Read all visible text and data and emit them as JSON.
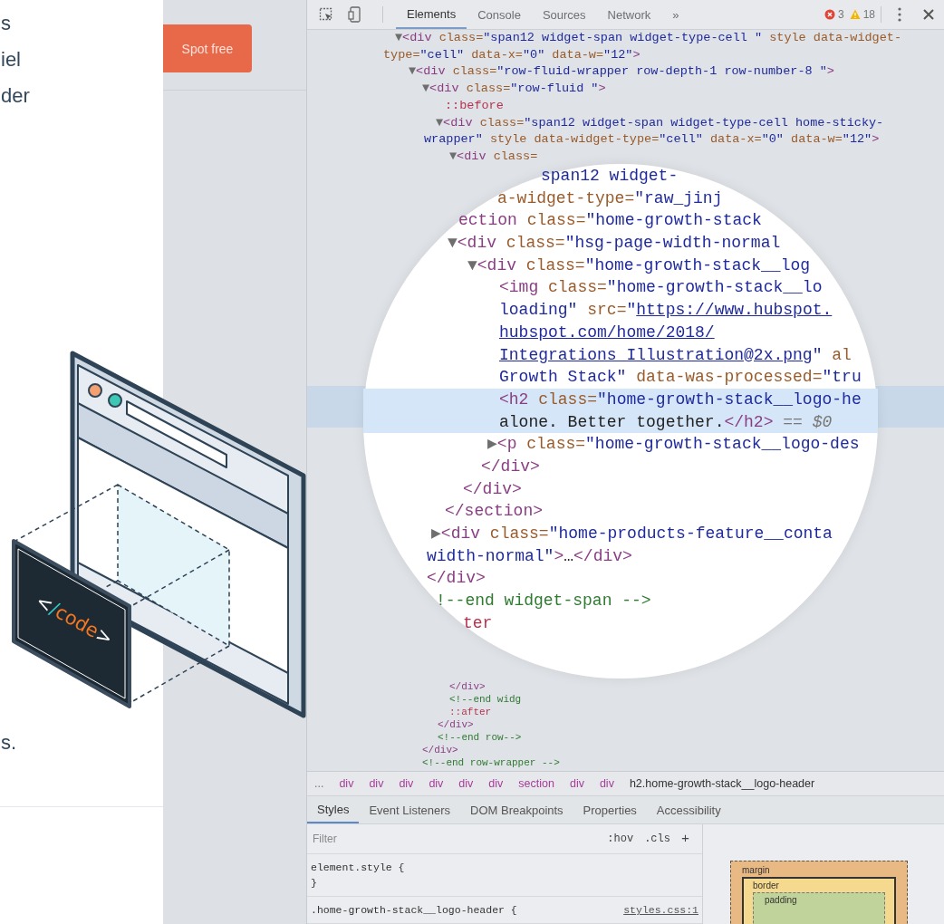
{
  "page": {
    "text_fragments": [
      "s",
      "iel",
      "der"
    ],
    "bottom_fragment": "s.",
    "cta_button": "Spot free"
  },
  "illustration": {
    "code_label": [
      {
        "text": "<",
        "kind": "bracket"
      },
      {
        "text": "/",
        "kind": "slash"
      },
      {
        "text": "code",
        "kind": "word"
      },
      {
        "text": ">",
        "kind": "bracket"
      }
    ]
  },
  "devtools": {
    "toolbar": {
      "tabs": [
        {
          "label": "Elements",
          "selected": true
        },
        {
          "label": "Console",
          "selected": false
        },
        {
          "label": "Sources",
          "selected": false
        },
        {
          "label": "Network",
          "selected": false
        }
      ],
      "overflow": "»",
      "errors": "3",
      "warnings": "18"
    },
    "dom_lines": [
      {
        "segments": [
          {
            "text": "▼",
            "kind": "arrow"
          },
          {
            "text": "<div ",
            "kind": "tag"
          },
          {
            "text": "class=",
            "kind": "attr"
          },
          {
            "text": "\"span12 widget-span widget-type-cell \"",
            "kind": "val"
          },
          {
            "text": " style data-widget-",
            "kind": "attr"
          }
        ]
      },
      {
        "segments": [
          {
            "text": "type=",
            "kind": "attr"
          },
          {
            "text": "\"cell\"",
            "kind": "val"
          },
          {
            "text": " data-x=",
            "kind": "attr"
          },
          {
            "text": "\"0\"",
            "kind": "val"
          },
          {
            "text": " data-w=",
            "kind": "attr"
          },
          {
            "text": "\"12\"",
            "kind": "val"
          },
          {
            "text": ">",
            "kind": "tag"
          }
        ]
      },
      {
        "segments": [
          {
            "text": "▼",
            "kind": "arrow"
          },
          {
            "text": "<div ",
            "kind": "tag"
          },
          {
            "text": "class=",
            "kind": "attr"
          },
          {
            "text": "\"row-fluid-wrapper row-depth-1 row-number-8 \"",
            "kind": "val"
          },
          {
            "text": ">",
            "kind": "tag"
          }
        ]
      },
      {
        "segments": [
          {
            "text": "▼",
            "kind": "arrow"
          },
          {
            "text": "<div ",
            "kind": "tag"
          },
          {
            "text": "class=",
            "kind": "attr"
          },
          {
            "text": "\"row-fluid \"",
            "kind": "val"
          },
          {
            "text": ">",
            "kind": "tag"
          }
        ]
      },
      {
        "segments": [
          {
            "text": "::before",
            "kind": "pseudo"
          }
        ]
      },
      {
        "segments": [
          {
            "text": "▼",
            "kind": "arrow"
          },
          {
            "text": "<div ",
            "kind": "tag"
          },
          {
            "text": "class=",
            "kind": "attr"
          },
          {
            "text": "\"span12 widget-span widget-type-cell home-sticky-",
            "kind": "val"
          }
        ]
      },
      {
        "segments": [
          {
            "text": "wrapper\"",
            "kind": "val"
          },
          {
            "text": " style data-widget-type=",
            "kind": "attr"
          },
          {
            "text": "\"cell\"",
            "kind": "val"
          },
          {
            "text": " data-x=",
            "kind": "attr"
          },
          {
            "text": "\"0\"",
            "kind": "val"
          },
          {
            "text": " data-w=",
            "kind": "attr"
          },
          {
            "text": "\"12\"",
            "kind": "val"
          },
          {
            "text": ">",
            "kind": "tag"
          }
        ]
      },
      {
        "segments": [
          {
            "text": "▼",
            "kind": "arrow"
          },
          {
            "text": "<div ",
            "kind": "tag"
          },
          {
            "text": "class=",
            "kind": "attr"
          }
        ]
      }
    ],
    "magnified_lines": [
      {
        "selected": false,
        "segments": [
          {
            "text": "span12 widget-",
            "kind": "val"
          }
        ]
      },
      {
        "selected": false,
        "segments": [
          {
            "text": "a-widget-type=",
            "kind": "attr"
          },
          {
            "text": "\"raw_jinj",
            "kind": "val"
          }
        ]
      },
      {
        "selected": false,
        "segments": [
          {
            "text": "ection ",
            "kind": "tag"
          },
          {
            "text": "class=",
            "kind": "attr"
          },
          {
            "text": "\"home-growth-stack",
            "kind": "val"
          }
        ]
      },
      {
        "selected": false,
        "segments": [
          {
            "text": "▼",
            "kind": "arrow"
          },
          {
            "text": "<div ",
            "kind": "tag"
          },
          {
            "text": "class=",
            "kind": "attr"
          },
          {
            "text": "\"hsg-page-width-normal",
            "kind": "val"
          }
        ]
      },
      {
        "selected": false,
        "segments": [
          {
            "text": "▼",
            "kind": "arrow"
          },
          {
            "text": "<div ",
            "kind": "tag"
          },
          {
            "text": "class=",
            "kind": "attr"
          },
          {
            "text": "\"home-growth-stack__log",
            "kind": "val"
          }
        ]
      },
      {
        "selected": false,
        "segments": [
          {
            "text": "<img ",
            "kind": "tag"
          },
          {
            "text": "class=",
            "kind": "attr"
          },
          {
            "text": "\"home-growth-stack__lo",
            "kind": "val"
          }
        ]
      },
      {
        "selected": false,
        "segments": [
          {
            "text": "loading\"",
            "kind": "val"
          },
          {
            "text": " src=",
            "kind": "attr"
          },
          {
            "text": "\"",
            "kind": "val"
          },
          {
            "text": "https://www.hubspot.",
            "kind": "link"
          }
        ]
      },
      {
        "selected": false,
        "segments": [
          {
            "text": "hubspot.com/home/2018/",
            "kind": "link"
          }
        ]
      },
      {
        "selected": false,
        "segments": [
          {
            "text": "Integrations Illustration@2x.png",
            "kind": "link"
          },
          {
            "text": "\"",
            "kind": "val"
          },
          {
            "text": " al",
            "kind": "attr"
          }
        ]
      },
      {
        "selected": false,
        "segments": [
          {
            "text": "Growth Stack\"",
            "kind": "val"
          },
          {
            "text": " data-was-processed=",
            "kind": "attr"
          },
          {
            "text": "\"tru",
            "kind": "val"
          }
        ]
      },
      {
        "selected": true,
        "segments": [
          {
            "text": "<h2 ",
            "kind": "tag"
          },
          {
            "text": "class=",
            "kind": "attr"
          },
          {
            "text": "\"home-growth-stack__logo-he",
            "kind": "val"
          }
        ]
      },
      {
        "selected": true,
        "segments": [
          {
            "text": "alone. Better together.",
            "kind": "text"
          },
          {
            "text": "</h2>",
            "kind": "tag"
          },
          {
            "text": " == $0",
            "kind": "muted"
          }
        ]
      },
      {
        "selected": false,
        "segments": [
          {
            "text": "▶",
            "kind": "arrow"
          },
          {
            "text": "<p ",
            "kind": "tag"
          },
          {
            "text": "class=",
            "kind": "attr"
          },
          {
            "text": "\"home-growth-stack__logo-des",
            "kind": "val"
          }
        ]
      },
      {
        "selected": false,
        "segments": [
          {
            "text": "</div>",
            "kind": "tag"
          }
        ]
      },
      {
        "selected": false,
        "segments": [
          {
            "text": "</div>",
            "kind": "tag"
          }
        ]
      },
      {
        "selected": false,
        "segments": [
          {
            "text": "</section>",
            "kind": "tag"
          }
        ]
      },
      {
        "selected": false,
        "segments": [
          {
            "text": "▶",
            "kind": "arrow"
          },
          {
            "text": "<div ",
            "kind": "tag"
          },
          {
            "text": "class=",
            "kind": "attr"
          },
          {
            "text": "\"home-products-feature__conta",
            "kind": "val"
          }
        ]
      },
      {
        "selected": false,
        "segments": [
          {
            "text": "width-normal\"",
            "kind": "val"
          },
          {
            "text": ">",
            "kind": "tag"
          },
          {
            "text": "…",
            "kind": "text"
          },
          {
            "text": "</div>",
            "kind": "tag"
          }
        ]
      },
      {
        "selected": false,
        "segments": [
          {
            "text": "</div>",
            "kind": "tag"
          }
        ]
      },
      {
        "selected": false,
        "segments": [
          {
            "text": "!--end widget-span -->",
            "kind": "comment"
          }
        ]
      },
      {
        "selected": false,
        "segments": [
          {
            "text": "ter",
            "kind": "pseudo"
          }
        ]
      }
    ],
    "dom_lines_after": [
      {
        "segments": [
          {
            "text": "</div>",
            "kind": "tag"
          }
        ]
      },
      {
        "segments": [
          {
            "text": "<!--end widg",
            "kind": "comment"
          }
        ]
      },
      {
        "segments": [
          {
            "text": "::after",
            "kind": "pseudo"
          }
        ]
      },
      {
        "segments": [
          {
            "text": "</div>",
            "kind": "tag"
          }
        ]
      },
      {
        "segments": [
          {
            "text": "<!--end row-->",
            "kind": "comment"
          }
        ]
      },
      {
        "segments": [
          {
            "text": "</div>",
            "kind": "tag"
          }
        ]
      },
      {
        "segments": [
          {
            "text": "<!--end row-wrapper -->",
            "kind": "comment"
          }
        ]
      }
    ],
    "breadcrumb": [
      {
        "label": "...",
        "kind": "more"
      },
      {
        "label": "div",
        "kind": "tag"
      },
      {
        "label": "div",
        "kind": "tag"
      },
      {
        "label": "div",
        "kind": "tag"
      },
      {
        "label": "div",
        "kind": "tag"
      },
      {
        "label": "div",
        "kind": "tag"
      },
      {
        "label": "div",
        "kind": "tag"
      },
      {
        "label": "section",
        "kind": "tag"
      },
      {
        "label": "div",
        "kind": "tag"
      },
      {
        "label": "div",
        "kind": "tag"
      },
      {
        "label": "h2.home-growth-stack__logo-header",
        "kind": "current"
      }
    ],
    "panel_tabs": [
      {
        "label": "Styles",
        "selected": true
      },
      {
        "label": "Event Listeners",
        "selected": false
      },
      {
        "label": "DOM Breakpoints",
        "selected": false
      },
      {
        "label": "Properties",
        "selected": false
      },
      {
        "label": "Accessibility",
        "selected": false
      }
    ],
    "styles": {
      "filter": {
        "placeholder": "Filter"
      },
      "hov": ":hov",
      "cls": ".cls",
      "add": "+",
      "rules": [
        {
          "selector": "element.style {",
          "close": "}"
        },
        {
          "selector": ".home-growth-stack__logo-header {",
          "source": "styles.css:1"
        }
      ]
    },
    "box_model": {
      "margin_label": "margin",
      "border_label": "border",
      "padding_label": "padding"
    }
  }
}
